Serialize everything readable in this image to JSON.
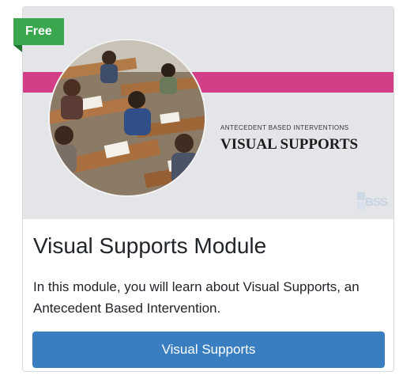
{
  "badge": {
    "label": "Free",
    "color": "#3aa74f"
  },
  "thumbnail": {
    "subtitle": "ANTECEDENT BASED INTERVENTIONS",
    "title": "VISUAL SUPPORTS",
    "logo_text": "BSS",
    "stripe_color": "#d23f86",
    "photo": "classroom-students-writing"
  },
  "card": {
    "title": "Visual Supports Module",
    "description": "In this module, you will learn about Visual Supports, an Antecedent Based Intervention.",
    "button_label": "Visual Supports",
    "button_color": "#3a7ec2"
  }
}
